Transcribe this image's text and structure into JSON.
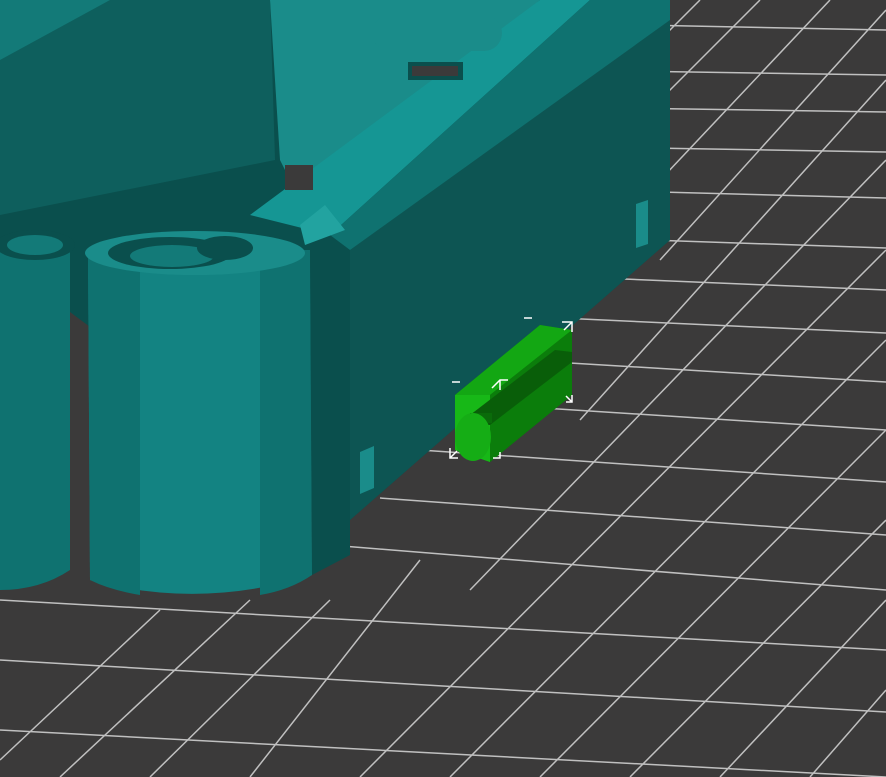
{
  "scene": {
    "type": "3d-slicer-viewport",
    "colors": {
      "background": "#3b3a3a",
      "grid": "#cfcfcf",
      "model_teal": "#0f7270",
      "model_teal_dark": "#0a4f4d",
      "model_teal_light": "#1a8c8a",
      "selected_green": "#13a713",
      "selected_green_dark": "#0b7d0b",
      "selection_box": "#ffffff"
    },
    "objects": [
      {
        "name": "main-model",
        "state": "unselected"
      },
      {
        "name": "small-clip-part",
        "state": "selected"
      }
    ]
  }
}
